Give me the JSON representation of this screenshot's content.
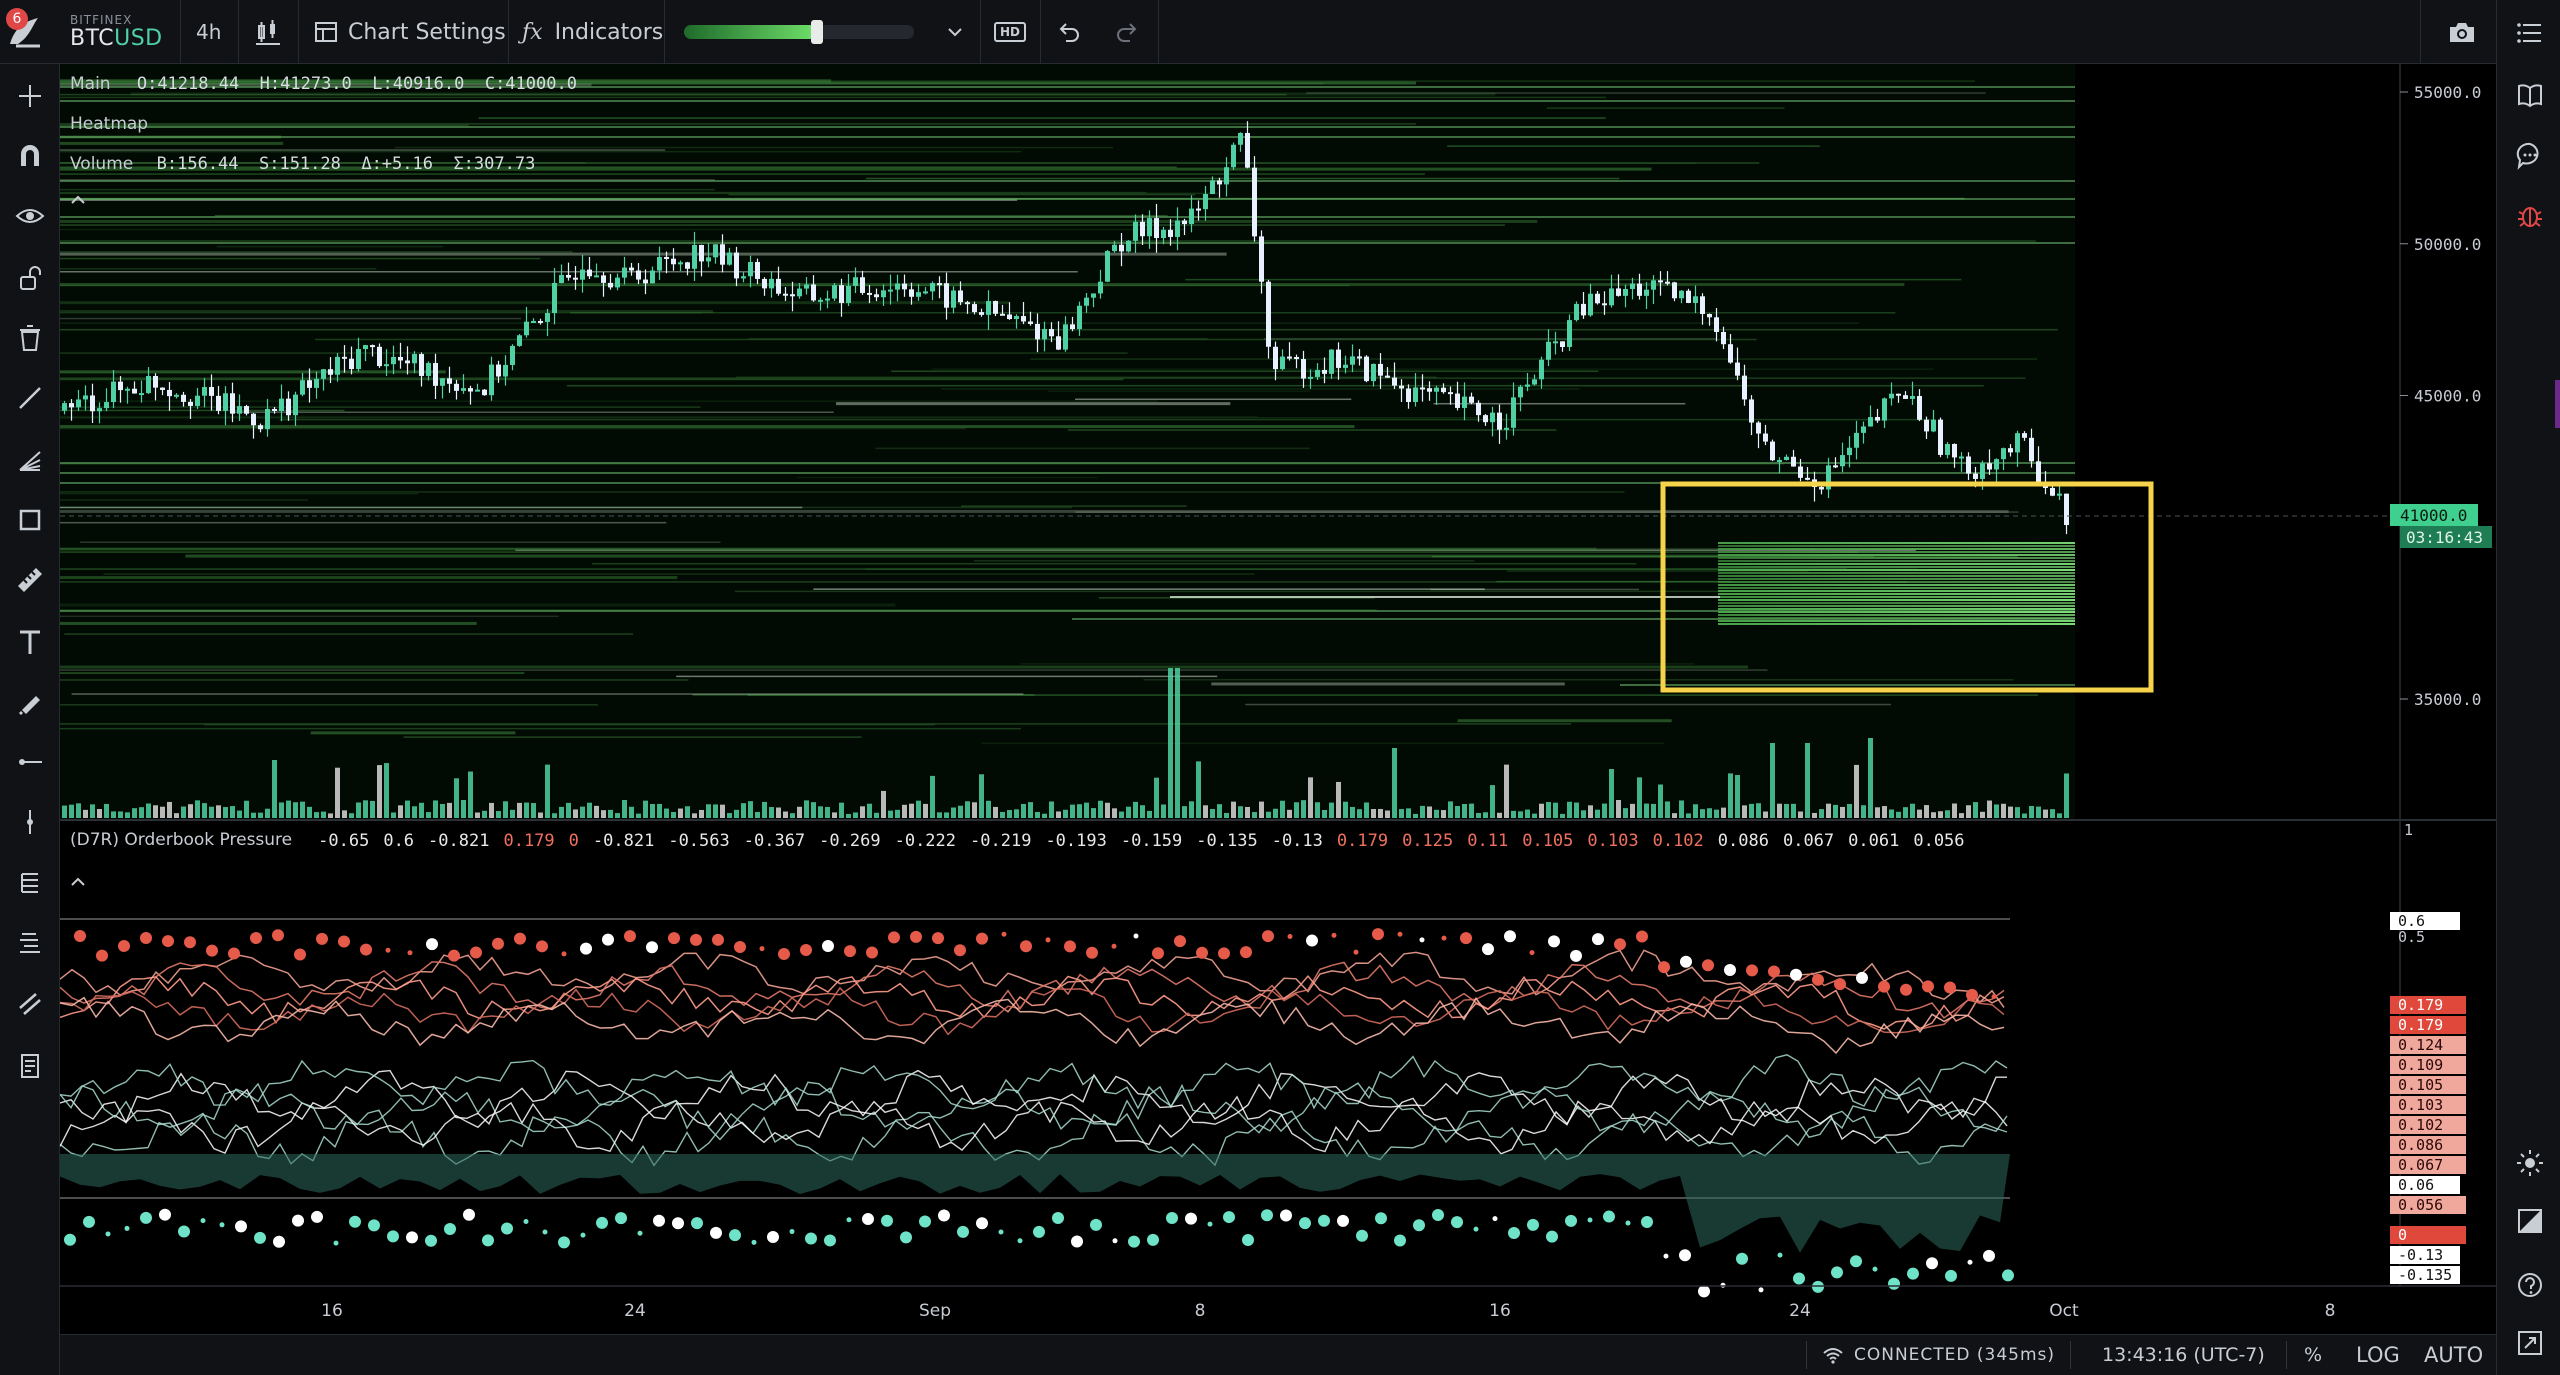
{
  "toolbar": {
    "badge_count": "6",
    "exchange": "BITFINEX",
    "symbol_prefix": "BTC",
    "symbol_suffix": "USD",
    "timeframe": "4h",
    "chart_settings_label": "Chart Settings",
    "indicators_label": "Indicators",
    "opacity_level": 0.58,
    "hd_label": "HD"
  },
  "legend": {
    "main_label": "Main",
    "main_values": "O:41218.44  H:41273.0  L:40916.0  C:41000.0",
    "heatmap_label": "Heatmap",
    "volume_label": "Volume",
    "volume_values": "B:156.44  S:151.28  Δ:+5.16  Σ:307.73",
    "pressure_label": "(D7R) Orderbook Pressure",
    "pressure_values": [
      {
        "v": "-0.65",
        "c": "#e8e8e8"
      },
      {
        "v": "0.6",
        "c": "#e8e8e8"
      },
      {
        "v": "-0.821",
        "c": "#e8e8e8"
      },
      {
        "v": "0.179",
        "c": "#f07060"
      },
      {
        "v": "0",
        "c": "#f07060"
      },
      {
        "v": "-0.821",
        "c": "#e8e8e8"
      },
      {
        "v": "-0.563",
        "c": "#e8e8e8"
      },
      {
        "v": "-0.367",
        "c": "#e8e8e8"
      },
      {
        "v": "-0.269",
        "c": "#e8e8e8"
      },
      {
        "v": "-0.222",
        "c": "#e8e8e8"
      },
      {
        "v": "-0.219",
        "c": "#e8e8e8"
      },
      {
        "v": "-0.193",
        "c": "#e8e8e8"
      },
      {
        "v": "-0.159",
        "c": "#e8e8e8"
      },
      {
        "v": "-0.135",
        "c": "#e8e8e8"
      },
      {
        "v": "-0.13",
        "c": "#e8e8e8"
      },
      {
        "v": "0.179",
        "c": "#f07060"
      },
      {
        "v": "0.125",
        "c": "#f07060"
      },
      {
        "v": "0.11",
        "c": "#f07060"
      },
      {
        "v": "0.105",
        "c": "#f07060"
      },
      {
        "v": "0.103",
        "c": "#f07060"
      },
      {
        "v": "0.102",
        "c": "#f07060"
      },
      {
        "v": "0.086",
        "c": "#e8e8e8"
      },
      {
        "v": "0.067",
        "c": "#e8e8e8"
      },
      {
        "v": "0.061",
        "c": "#e8e8e8"
      },
      {
        "v": "0.056",
        "c": "#e8e8e8"
      }
    ]
  },
  "price_axis": {
    "ticks": [
      "55000.0",
      "50000.0",
      "45000.0",
      "35000.0"
    ],
    "last_price": "41000.0",
    "countdown": "03:16:43",
    "volume_tick": "1"
  },
  "pressure_axis": {
    "labels": [
      {
        "t": "0.6",
        "kind": "white"
      },
      {
        "t": "0.5",
        "kind": "plain"
      },
      {
        "t": "0.179",
        "kind": "red"
      },
      {
        "t": "0.179",
        "kind": "red"
      },
      {
        "t": "0.124",
        "kind": "pink"
      },
      {
        "t": "0.109",
        "kind": "pink"
      },
      {
        "t": "0.105",
        "kind": "pink"
      },
      {
        "t": "0.103",
        "kind": "pink"
      },
      {
        "t": "0.102",
        "kind": "pink"
      },
      {
        "t": "0.086",
        "kind": "pink"
      },
      {
        "t": "0.067",
        "kind": "pink"
      },
      {
        "t": "0.06",
        "kind": "white"
      },
      {
        "t": "0.056",
        "kind": "pink"
      },
      {
        "t": "0",
        "kind": "red"
      },
      {
        "t": "-0.13",
        "kind": "white"
      },
      {
        "t": "-0.135",
        "kind": "white"
      }
    ]
  },
  "time_axis": [
    "16",
    "24",
    "Sep",
    "8",
    "16",
    "24",
    "Oct",
    "8"
  ],
  "status": {
    "connection": "CONNECTED (345ms)",
    "time": "13:43:16 (UTC-7)",
    "percent": "%",
    "log": "LOG",
    "auto": "AUTO"
  },
  "colors": {
    "bull": "#4fd1a5",
    "bear": "#e9f0ff",
    "highlight": "#f5d34a",
    "pressure_red": "#e65a4a",
    "pressure_teal": "#6fe3c8"
  }
}
